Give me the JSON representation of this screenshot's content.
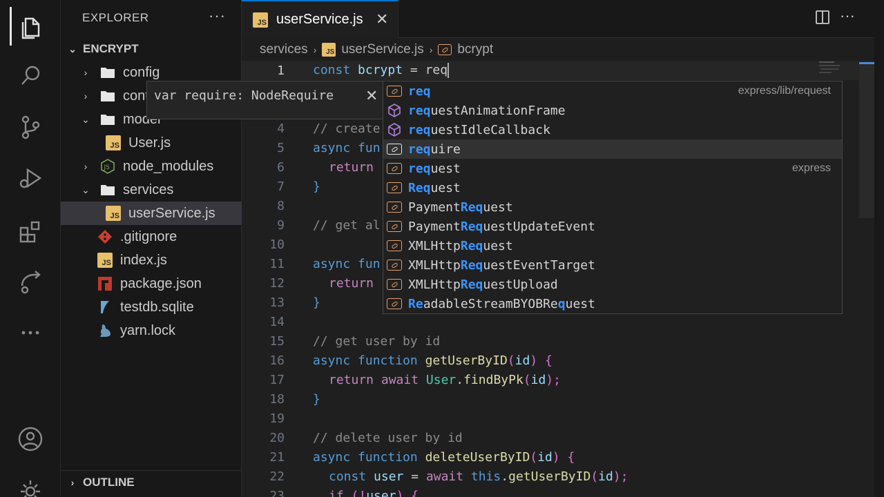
{
  "sidebar": {
    "title": "EXPLORER",
    "project": "ENCRYPT",
    "outline": "OUTLINE",
    "items": [
      {
        "label": "config"
      },
      {
        "label": "cont"
      },
      {
        "label": "model"
      },
      {
        "label": "User.js"
      },
      {
        "label": "node_modules"
      },
      {
        "label": "services"
      },
      {
        "label": "userService.js"
      },
      {
        "label": ".gitignore"
      },
      {
        "label": "index.js"
      },
      {
        "label": "package.json"
      },
      {
        "label": "testdb.sqlite"
      },
      {
        "label": "yarn.lock"
      }
    ]
  },
  "tab": {
    "label": "userService.js",
    "badge": "JS"
  },
  "breadcrumb": {
    "folder": "services",
    "file": "userService.js",
    "symbol": "bcrypt"
  },
  "hover": {
    "text": "var require: NodeRequire"
  },
  "editor": {
    "line_numbers": [
      "1",
      "4",
      "5",
      "6",
      "7",
      "8",
      "9",
      "10",
      "11",
      "12",
      "13",
      "14",
      "15",
      "16",
      "17",
      "18",
      "19",
      "20",
      "21",
      "22",
      "23"
    ],
    "line1": {
      "kw": "const",
      "var": " bcrypt",
      "op": " = ",
      "typed": "req"
    },
    "line4": "// create",
    "line5": {
      "kw": "async",
      "fn": " fun"
    },
    "line6": {
      "kw": "return"
    },
    "line7": "}",
    "line9": "// get al",
    "line11": {
      "kw": "async",
      "fn": " fun"
    },
    "line12": {
      "kw": "return"
    },
    "line13": "}",
    "line15": "// get user by id",
    "line16": {
      "kw": "async",
      "kw2": " function",
      "fn": " getUserByID",
      "p1": "(",
      "arg": "id",
      "p2": ") {"
    },
    "line17": {
      "kw": "return",
      "kw2": " await",
      "cls": " User",
      "dot": ".",
      "fn": "findByPk",
      "p1": "(",
      "arg": "id",
      "p2": ");"
    },
    "line18": "}",
    "line20": "// delete user by id",
    "line21": {
      "kw": "async",
      "kw2": " function",
      "fn": " deleteUserByID",
      "p1": "(",
      "arg": "id",
      "p2": ") {"
    },
    "line22": {
      "kw": "const",
      "var": " user",
      "op": " = ",
      "kw2": "await",
      "kw3": " this",
      "dot": ".",
      "fn": "getUserByID",
      "p1": "(",
      "arg": "id",
      "p2": ");"
    },
    "line23": {
      "kw": "if",
      "rest": " (!",
      "var": "user",
      "p2": ") {"
    }
  },
  "suggestions": [
    {
      "hl": "req",
      "rest": "",
      "icon": "variable",
      "detail": "express/lib/request"
    },
    {
      "hl": "req",
      "rest": "uestAnimationFrame",
      "icon": "method",
      "detail": ""
    },
    {
      "hl": "req",
      "rest": "uestIdleCallback",
      "icon": "method",
      "detail": ""
    },
    {
      "hl": "req",
      "rest": "uire",
      "icon": "variable",
      "detail": ""
    },
    {
      "hl": "req",
      "rest": "uest",
      "icon": "variable",
      "detail": "express"
    },
    {
      "hl": "Req",
      "rest": "uest",
      "icon": "variable",
      "detail": ""
    },
    {
      "pre": "Payment",
      "hl": "Req",
      "rest": "uest",
      "icon": "variable",
      "detail": ""
    },
    {
      "pre": "Payment",
      "hl": "Req",
      "rest": "uestUpdateEvent",
      "icon": "variable",
      "detail": ""
    },
    {
      "pre": "XMLHttp",
      "hl": "Req",
      "rest": "uest",
      "icon": "variable",
      "detail": ""
    },
    {
      "pre": "XMLHttp",
      "hl": "Req",
      "rest": "uestEventTarget",
      "icon": "variable",
      "detail": ""
    },
    {
      "pre": "XMLHttp",
      "hl": "Req",
      "rest": "uestUpload",
      "icon": "variable",
      "detail": ""
    },
    {
      "pre": "",
      "hl": "Re",
      "rest": "adableStreamBYOBRe",
      "hl2": "q",
      "rest2": "uest",
      "icon": "variable",
      "detail": ""
    }
  ],
  "colors": {
    "accent": "#0078d4",
    "highlight": "#3b94ff",
    "js_badge": "#e8bf6a"
  }
}
